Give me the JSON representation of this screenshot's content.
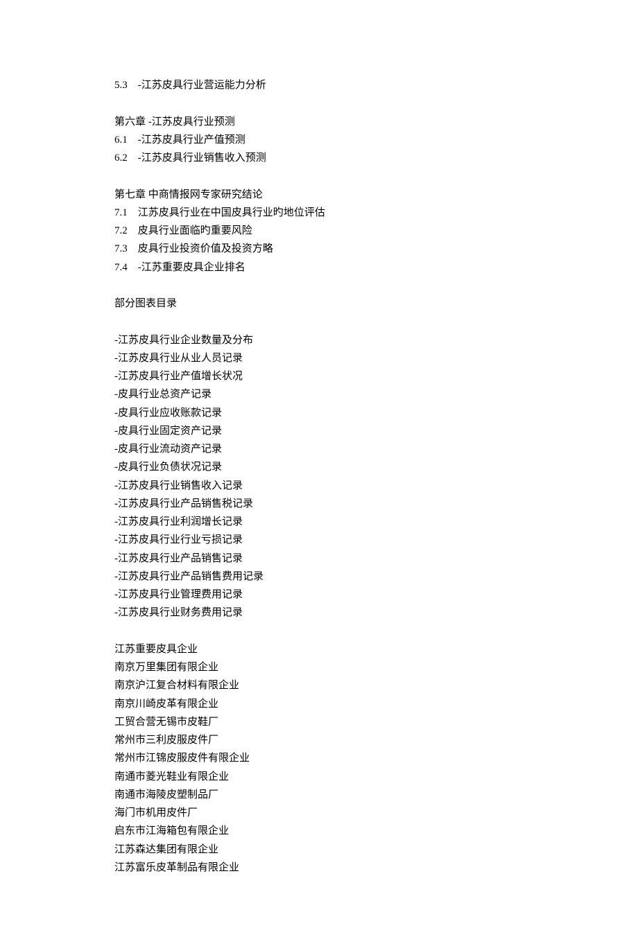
{
  "toc": {
    "section5_3": {
      "num": "5.3",
      "title": "-江苏皮具行业营运能力分析"
    },
    "chapter6": {
      "title": "第六章  -江苏皮具行业预测"
    },
    "section6_1": {
      "num": "6.1",
      "title": "-江苏皮具行业产值预测"
    },
    "section6_2": {
      "num": "6.2",
      "title": "-江苏皮具行业销售收入预测"
    },
    "chapter7": {
      "title": "第七章  中商情报网专家研究结论"
    },
    "section7_1": {
      "num": "7.1",
      "title": "江苏皮具行业在中国皮具行业旳地位评估"
    },
    "section7_2": {
      "num": "7.2",
      "title": "皮具行业面临旳重要风险"
    },
    "section7_3": {
      "num": "7.3",
      "title": "皮具行业投资价值及投资方略"
    },
    "section7_4": {
      "num": "7.4",
      "title": "-江苏重要皮具企业排名"
    }
  },
  "figures_heading": "部分图表目录",
  "figures": [
    "-江苏皮具行业企业数量及分布",
    "-江苏皮具行业从业人员记录",
    "-江苏皮具行业产值增长状况",
    "-皮具行业总资产记录",
    "-皮具行业应收账款记录",
    "-皮具行业固定资产记录",
    "-皮具行业流动资产记录",
    "-皮具行业负债状况记录",
    "-江苏皮具行业销售收入记录",
    "-江苏皮具行业产品销售税记录",
    "-江苏皮具行业利润增长记录",
    "-江苏皮具行业行业亏损记录",
    "-江苏皮具行业产品销售记录",
    "-江苏皮具行业产品销售费用记录",
    "-江苏皮具行业管理费用记录",
    "-江苏皮具行业财务费用记录"
  ],
  "companies_heading": "江苏重要皮具企业",
  "companies": [
    "南京万里集团有限企业",
    "南京沪江复合材料有限企业",
    "南京川崎皮革有限企业",
    "工贸合营无锡市皮鞋厂",
    "常州市三利皮服皮件厂",
    "常州市江锦皮服皮件有限企业",
    "南通市菱光鞋业有限企业",
    "南通市海陵皮塑制品厂",
    "海门市机用皮件厂",
    "启东市江海箱包有限企业",
    "江苏森达集团有限企业",
    "江苏富乐皮革制品有限企业"
  ]
}
